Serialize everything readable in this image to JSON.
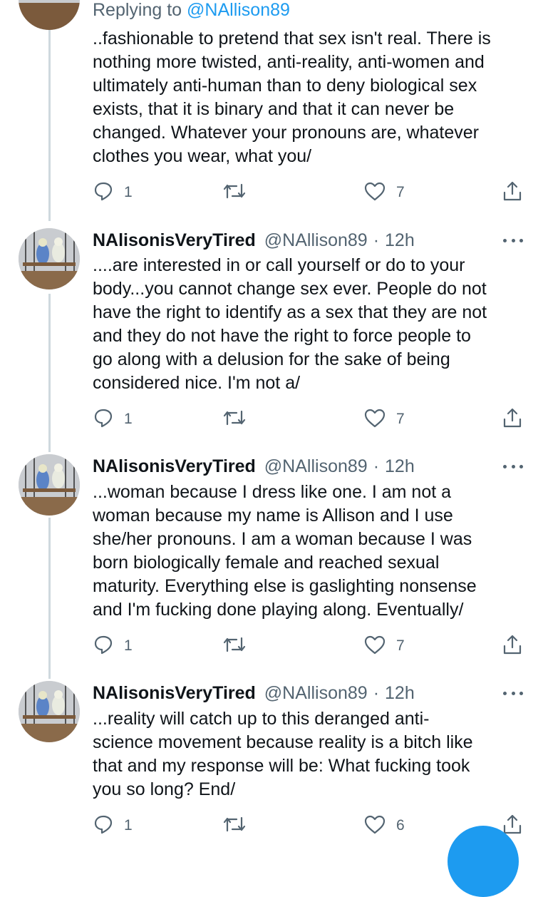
{
  "thread": {
    "replying": {
      "prefix": "Replying to",
      "mention": "@NAllison89"
    },
    "tweets": [
      {
        "lines": [
          "..fashionable to pretend that sex isn't real. There is",
          "nothing more twisted, anti-reality, anti-women and",
          "ultimately anti-human than to deny biological sex",
          "exists, that it is binary and that it can never be",
          "changed. Whatever your pronouns are, whatever",
          "clothes you wear, what you/"
        ],
        "reply_count": "1",
        "like_count": "7"
      },
      {
        "name": "NAlisonisVeryTired",
        "handle": "@NAllison89",
        "separator": "·",
        "time": "12h",
        "lines": [
          "....are interested in or call yourself or do to your",
          "body...you cannot change sex ever. People do not",
          "have the right to identify as a sex that they are not",
          "and they do not have the right to force people to",
          "go along with a delusion for the sake of being",
          "considered nice. I'm not a/"
        ],
        "reply_count": "1",
        "like_count": "7"
      },
      {
        "name": "NAlisonisVeryTired",
        "handle": "@NAllison89",
        "separator": "·",
        "time": "12h",
        "lines": [
          "...woman because I dress like one. I am not a",
          "woman because my name is Allison and I use",
          "she/her pronouns. I am a woman because I was",
          "born biologically female and reached sexual",
          "maturity. Everything else is gaslighting nonsense",
          "and I'm fucking done playing along. Eventually/"
        ],
        "reply_count": "1",
        "like_count": "7"
      },
      {
        "name": "NAlisonisVeryTired",
        "handle": "@NAllison89",
        "separator": "·",
        "time": "12h",
        "lines": [
          "...reality will catch up to this deranged anti-",
          "science movement because reality is a bitch like",
          "that and my response will be: What fucking took",
          "you so long? End/"
        ],
        "reply_count": "1",
        "like_count": "6"
      }
    ]
  },
  "icons": {
    "reply": "reply-icon",
    "retweet": "retweet-icon",
    "like": "heart-icon",
    "share": "share-icon",
    "more": "more-icon",
    "compose": "compose-fab"
  },
  "colors": {
    "text": "#0f1419",
    "secondary": "#536471",
    "accent": "#1d9bf0",
    "thread_line": "#cfd9de"
  }
}
